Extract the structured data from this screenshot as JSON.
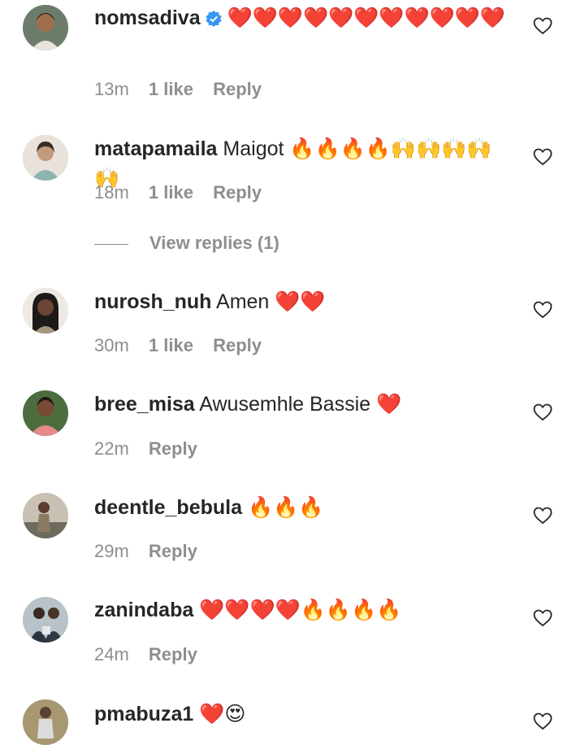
{
  "comments": [
    {
      "username": "nomsadiva",
      "verified": true,
      "text": "❤️❤️❤️❤️❤️❤️❤️❤️❤️❤️❤️",
      "time": "13m",
      "likes": "1 like",
      "reply": "Reply",
      "avatar_color": "#7a6a5a"
    },
    {
      "username": "matapamaila",
      "verified": false,
      "text": "Maigot 🔥🔥🔥🔥🙌🙌🙌🙌🙌",
      "time": "18m",
      "likes": "1 like",
      "reply": "Reply",
      "view_replies": "View replies (1)",
      "avatar_color": "#d9c9b4"
    },
    {
      "username": "nurosh_nuh",
      "verified": false,
      "text": "Amen ❤️❤️",
      "time": "30m",
      "likes": "1 like",
      "reply": "Reply",
      "avatar_color": "#5b3f2f"
    },
    {
      "username": "bree_misa",
      "verified": false,
      "text": "Awusemhle Bassie ❤️",
      "time": "22m",
      "likes": "",
      "reply": "Reply",
      "avatar_color": "#b46a62"
    },
    {
      "username": "deentle_bebula",
      "verified": false,
      "text": "🔥🔥🔥",
      "time": "29m",
      "likes": "",
      "reply": "Reply",
      "avatar_color": "#8a8476"
    },
    {
      "username": "zanindaba",
      "verified": false,
      "text": "❤️❤️❤️❤️🔥🔥🔥🔥",
      "time": "24m",
      "likes": "",
      "reply": "Reply",
      "avatar_color": "#3b4450"
    },
    {
      "username": "pmabuza1",
      "verified": false,
      "text": "❤️😍",
      "time": "",
      "likes": "",
      "reply": "",
      "avatar_color": "#9a8c6e"
    }
  ],
  "colors": {
    "text": "#262626",
    "muted": "#8e8e8e",
    "verified_blue": "#3897f0",
    "background": "#ffffff"
  },
  "icons": {
    "like": "heart-outline-icon",
    "verified": "verified-badge-icon"
  }
}
